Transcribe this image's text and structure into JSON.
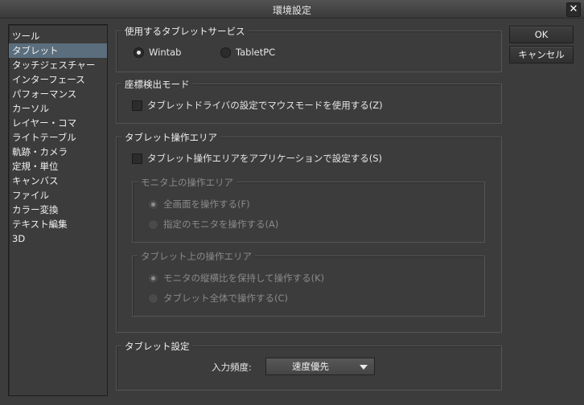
{
  "window": {
    "title": "環境設定",
    "close_glyph": "✕"
  },
  "sidebar": {
    "items": [
      {
        "label": "ツール"
      },
      {
        "label": "タブレット",
        "selected": true
      },
      {
        "label": "タッチジェスチャー"
      },
      {
        "label": "インターフェース"
      },
      {
        "label": "パフォーマンス"
      },
      {
        "label": "カーソル"
      },
      {
        "label": "レイヤー・コマ"
      },
      {
        "label": "ライトテーブル"
      },
      {
        "label": "軌跡・カメラ"
      },
      {
        "label": "定規・単位"
      },
      {
        "label": "キャンバス"
      },
      {
        "label": "ファイル"
      },
      {
        "label": "カラー変換"
      },
      {
        "label": "テキスト編集"
      },
      {
        "label": "3D"
      }
    ]
  },
  "buttons": {
    "ok": "OK",
    "cancel": "キャンセル"
  },
  "tablet_service": {
    "title": "使用するタブレットサービス",
    "options": [
      {
        "label": "Wintab",
        "checked": true
      },
      {
        "label": "TabletPC",
        "checked": false
      }
    ]
  },
  "coordinate_mode": {
    "title": "座標検出モード",
    "checkbox_label": "タブレットドライバの設定でマウスモードを使用する(Z)",
    "checked": false
  },
  "tablet_area": {
    "title": "タブレット操作エリア",
    "checkbox_label": "タブレット操作エリアをアプリケーションで設定する(S)",
    "checked": false,
    "monitor_area": {
      "title": "モニタ上の操作エリア",
      "options": [
        {
          "label": "全画面を操作する(F)",
          "checked": true
        },
        {
          "label": "指定のモニタを操作する(A)",
          "checked": false
        }
      ]
    },
    "tablet_surface": {
      "title": "タブレット上の操作エリア",
      "options": [
        {
          "label": "モニタの縦横比を保持して操作する(K)",
          "checked": true
        },
        {
          "label": "タブレット全体で操作する(C)",
          "checked": false
        }
      ]
    }
  },
  "tablet_settings": {
    "title": "タブレット設定",
    "input_frequency_label": "入力頻度:",
    "input_frequency_value": "速度優先"
  }
}
